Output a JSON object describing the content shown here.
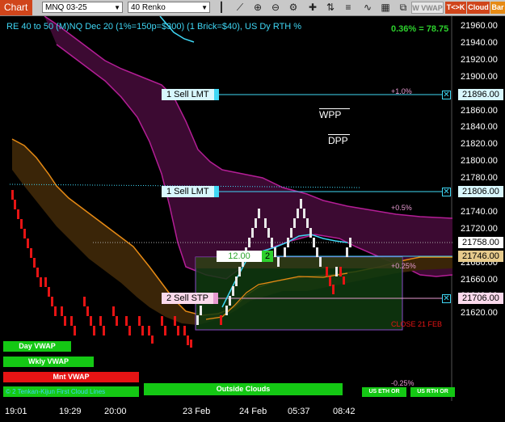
{
  "toolbar": {
    "chart_tab": "Chart",
    "instrument": "MNQ 03-25",
    "bar_type": "40 Renko",
    "buttons": {
      "wvwap": "W VWAP",
      "tk": "T<>K",
      "cloud": "Cloud",
      "bar": "Bar"
    }
  },
  "chart": {
    "title": "RE 40 to 50 (M)NQ Dec 20 (1%=150p=$300) (1 Brick=$40), US Dy RTH %",
    "performance": "0.36% = 78.75",
    "y_ticks": [
      "21960.00",
      "21940.00",
      "21920.00",
      "21900.00",
      "21880.00",
      "21860.00",
      "21840.00",
      "21820.00",
      "21800.00",
      "21780.00",
      "21760.00",
      "21740.00",
      "21720.00",
      "21700.00",
      "21680.00",
      "21660.00",
      "21640.00",
      "21620.00"
    ],
    "x_ticks": [
      "19:01",
      "19:29",
      "20:00",
      "23 Feb",
      "24 Feb",
      "05:37",
      "08:42"
    ],
    "orders": [
      {
        "label": "1 Sell LMT",
        "price": "21896.00"
      },
      {
        "label": "1 Sell LMT",
        "price": "21806.00"
      },
      {
        "label": "2 Sell STP",
        "price": "21706.00"
      }
    ],
    "last_price": "21758.00",
    "position_price": "21746.00",
    "position_avg": "12.00",
    "position_qty": "2",
    "pct_levels": [
      "+1.0%",
      "+0.5%",
      "+0.25%",
      "-0.25%"
    ],
    "pivots": [
      "WPP",
      "DPP"
    ],
    "close_label": "CLOSE 21 FEB",
    "vwap_buttons": [
      "Day VWAP",
      "Wkly VWAP",
      "Mnt VWAP"
    ],
    "bottom_label": "Outside Clouds",
    "legend_text": "© 2 Tenkan-Kijun First Cloud Lines",
    "eth_or": "US ETH OR",
    "rth_or": "US RTH OR"
  },
  "colors": {
    "cyan": "#3fd7f5",
    "green": "#00c800",
    "magenta": "#b41e96",
    "orange": "#e68a14",
    "red": "#e61414"
  }
}
